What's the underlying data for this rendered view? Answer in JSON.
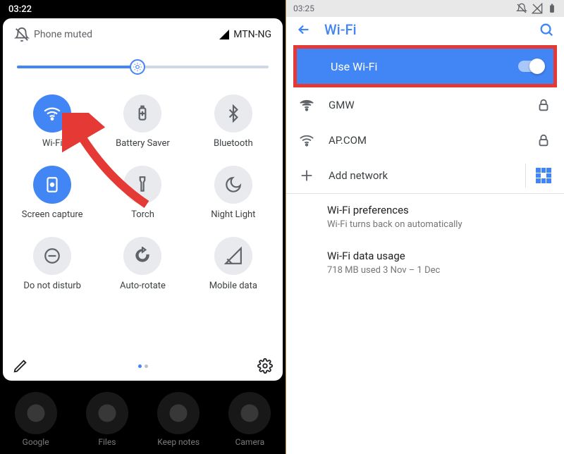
{
  "left": {
    "status_time": "03:22",
    "mute_label": "Phone muted",
    "carrier": "MTN-NG",
    "tiles": [
      {
        "label": "Wi-Fi",
        "on": true,
        "icon": "wifi"
      },
      {
        "label": "Battery Saver",
        "on": false,
        "icon": "battery"
      },
      {
        "label": "Bluetooth",
        "on": false,
        "icon": "bluetooth"
      },
      {
        "label": "Screen capture",
        "on": true,
        "icon": "capture"
      },
      {
        "label": "Torch",
        "on": false,
        "icon": "torch"
      },
      {
        "label": "Night Light",
        "on": false,
        "icon": "moon"
      },
      {
        "label": "Do not disturb",
        "on": false,
        "icon": "dnd"
      },
      {
        "label": "Auto-rotate",
        "on": false,
        "icon": "rotate"
      },
      {
        "label": "Mobile data",
        "on": false,
        "icon": "mdata"
      }
    ],
    "dock": [
      {
        "label": "Google"
      },
      {
        "label": "Files"
      },
      {
        "label": "Keep notes"
      },
      {
        "label": "Camera"
      }
    ],
    "brightness_pct": 48
  },
  "right": {
    "status_time": "03:25",
    "page_title": "Wi-Fi",
    "use_wifi_label": "Use Wi-Fi",
    "use_wifi_on": true,
    "networks": [
      {
        "name": "GMW",
        "signal": "full",
        "secured": true
      },
      {
        "name": "AP.COM",
        "signal": "empty",
        "secured": true
      }
    ],
    "add_network_label": "Add network",
    "preferences": {
      "title": "Wi-Fi preferences",
      "subtitle": "Wi-Fi turns back on automatically"
    },
    "data_usage": {
      "title": "Wi-Fi data usage",
      "subtitle": "718 MB used 3 Nov – 1 Dec"
    }
  },
  "colors": {
    "accent": "#4285f4",
    "highlight": "#e53935"
  }
}
